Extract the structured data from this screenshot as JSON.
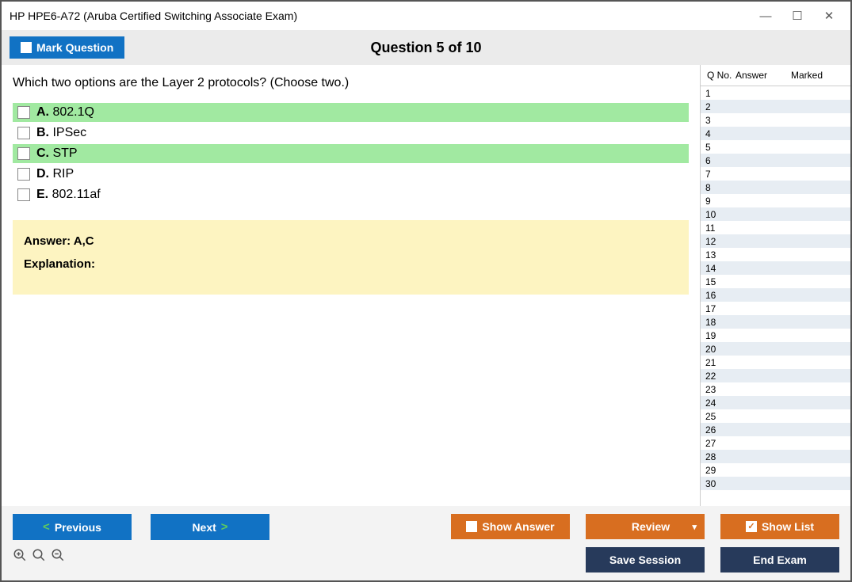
{
  "window": {
    "title": "HP HPE6-A72 (Aruba Certified Switching Associate Exam)"
  },
  "header": {
    "mark_label": "Mark Question",
    "question_title": "Question 5 of 10"
  },
  "question": {
    "text": "Which two options are the Layer 2 protocols? (Choose two.)",
    "options": [
      {
        "letter": "A.",
        "text": "802.1Q",
        "selected": true
      },
      {
        "letter": "B.",
        "text": "IPSec",
        "selected": false
      },
      {
        "letter": "C.",
        "text": "STP",
        "selected": true
      },
      {
        "letter": "D.",
        "text": "RIP",
        "selected": false
      },
      {
        "letter": "E.",
        "text": "802.11af",
        "selected": false
      }
    ],
    "answer_label": "Answer: A,C",
    "explanation_label": "Explanation:"
  },
  "sidebar": {
    "headers": {
      "qno": "Q No.",
      "answer": "Answer",
      "marked": "Marked"
    },
    "rows": [
      1,
      2,
      3,
      4,
      5,
      6,
      7,
      8,
      9,
      10,
      11,
      12,
      13,
      14,
      15,
      16,
      17,
      18,
      19,
      20,
      21,
      22,
      23,
      24,
      25,
      26,
      27,
      28,
      29,
      30
    ]
  },
  "footer": {
    "prev": "Previous",
    "next": "Next",
    "show_answer": "Show Answer",
    "review": "Review",
    "show_list": "Show List",
    "save_session": "Save Session",
    "end_exam": "End Exam"
  }
}
